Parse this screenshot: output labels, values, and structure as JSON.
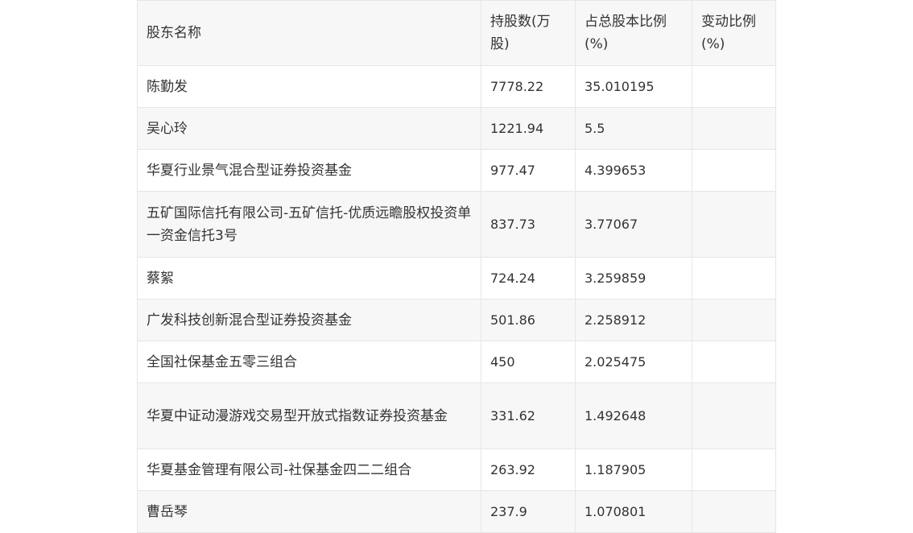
{
  "table": {
    "headers": [
      "股东名称",
      "持股数(万股)",
      "占总股本比例(%)",
      "变动比例(%)"
    ],
    "rows": [
      {
        "name": "陈勤发",
        "shares": "7778.22",
        "ratio": "35.010195",
        "change": ""
      },
      {
        "name": "吴心玲",
        "shares": "1221.94",
        "ratio": "5.5",
        "change": ""
      },
      {
        "name": "华夏行业景气混合型证券投资基金",
        "shares": "977.47",
        "ratio": "4.399653",
        "change": ""
      },
      {
        "name": "五矿国际信托有限公司-五矿信托-优质远瞻股权投资单一资金信托3号",
        "shares": "837.73",
        "ratio": "3.77067",
        "change": ""
      },
      {
        "name": "蔡絮",
        "shares": "724.24",
        "ratio": "3.259859",
        "change": ""
      },
      {
        "name": "广发科技创新混合型证券投资基金",
        "shares": "501.86",
        "ratio": "2.258912",
        "change": ""
      },
      {
        "name": "全国社保基金五零三组合",
        "shares": "450",
        "ratio": "2.025475",
        "change": ""
      },
      {
        "name": "华夏中证动漫游戏交易型开放式指数证券投资基金",
        "shares": "331.62",
        "ratio": "1.492648",
        "change": ""
      },
      {
        "name": "华夏基金管理有限公司-社保基金四二二组合",
        "shares": "263.92",
        "ratio": "1.187905",
        "change": ""
      },
      {
        "name": "曹岳琴",
        "shares": "237.9",
        "ratio": "1.070801",
        "change": ""
      }
    ]
  }
}
